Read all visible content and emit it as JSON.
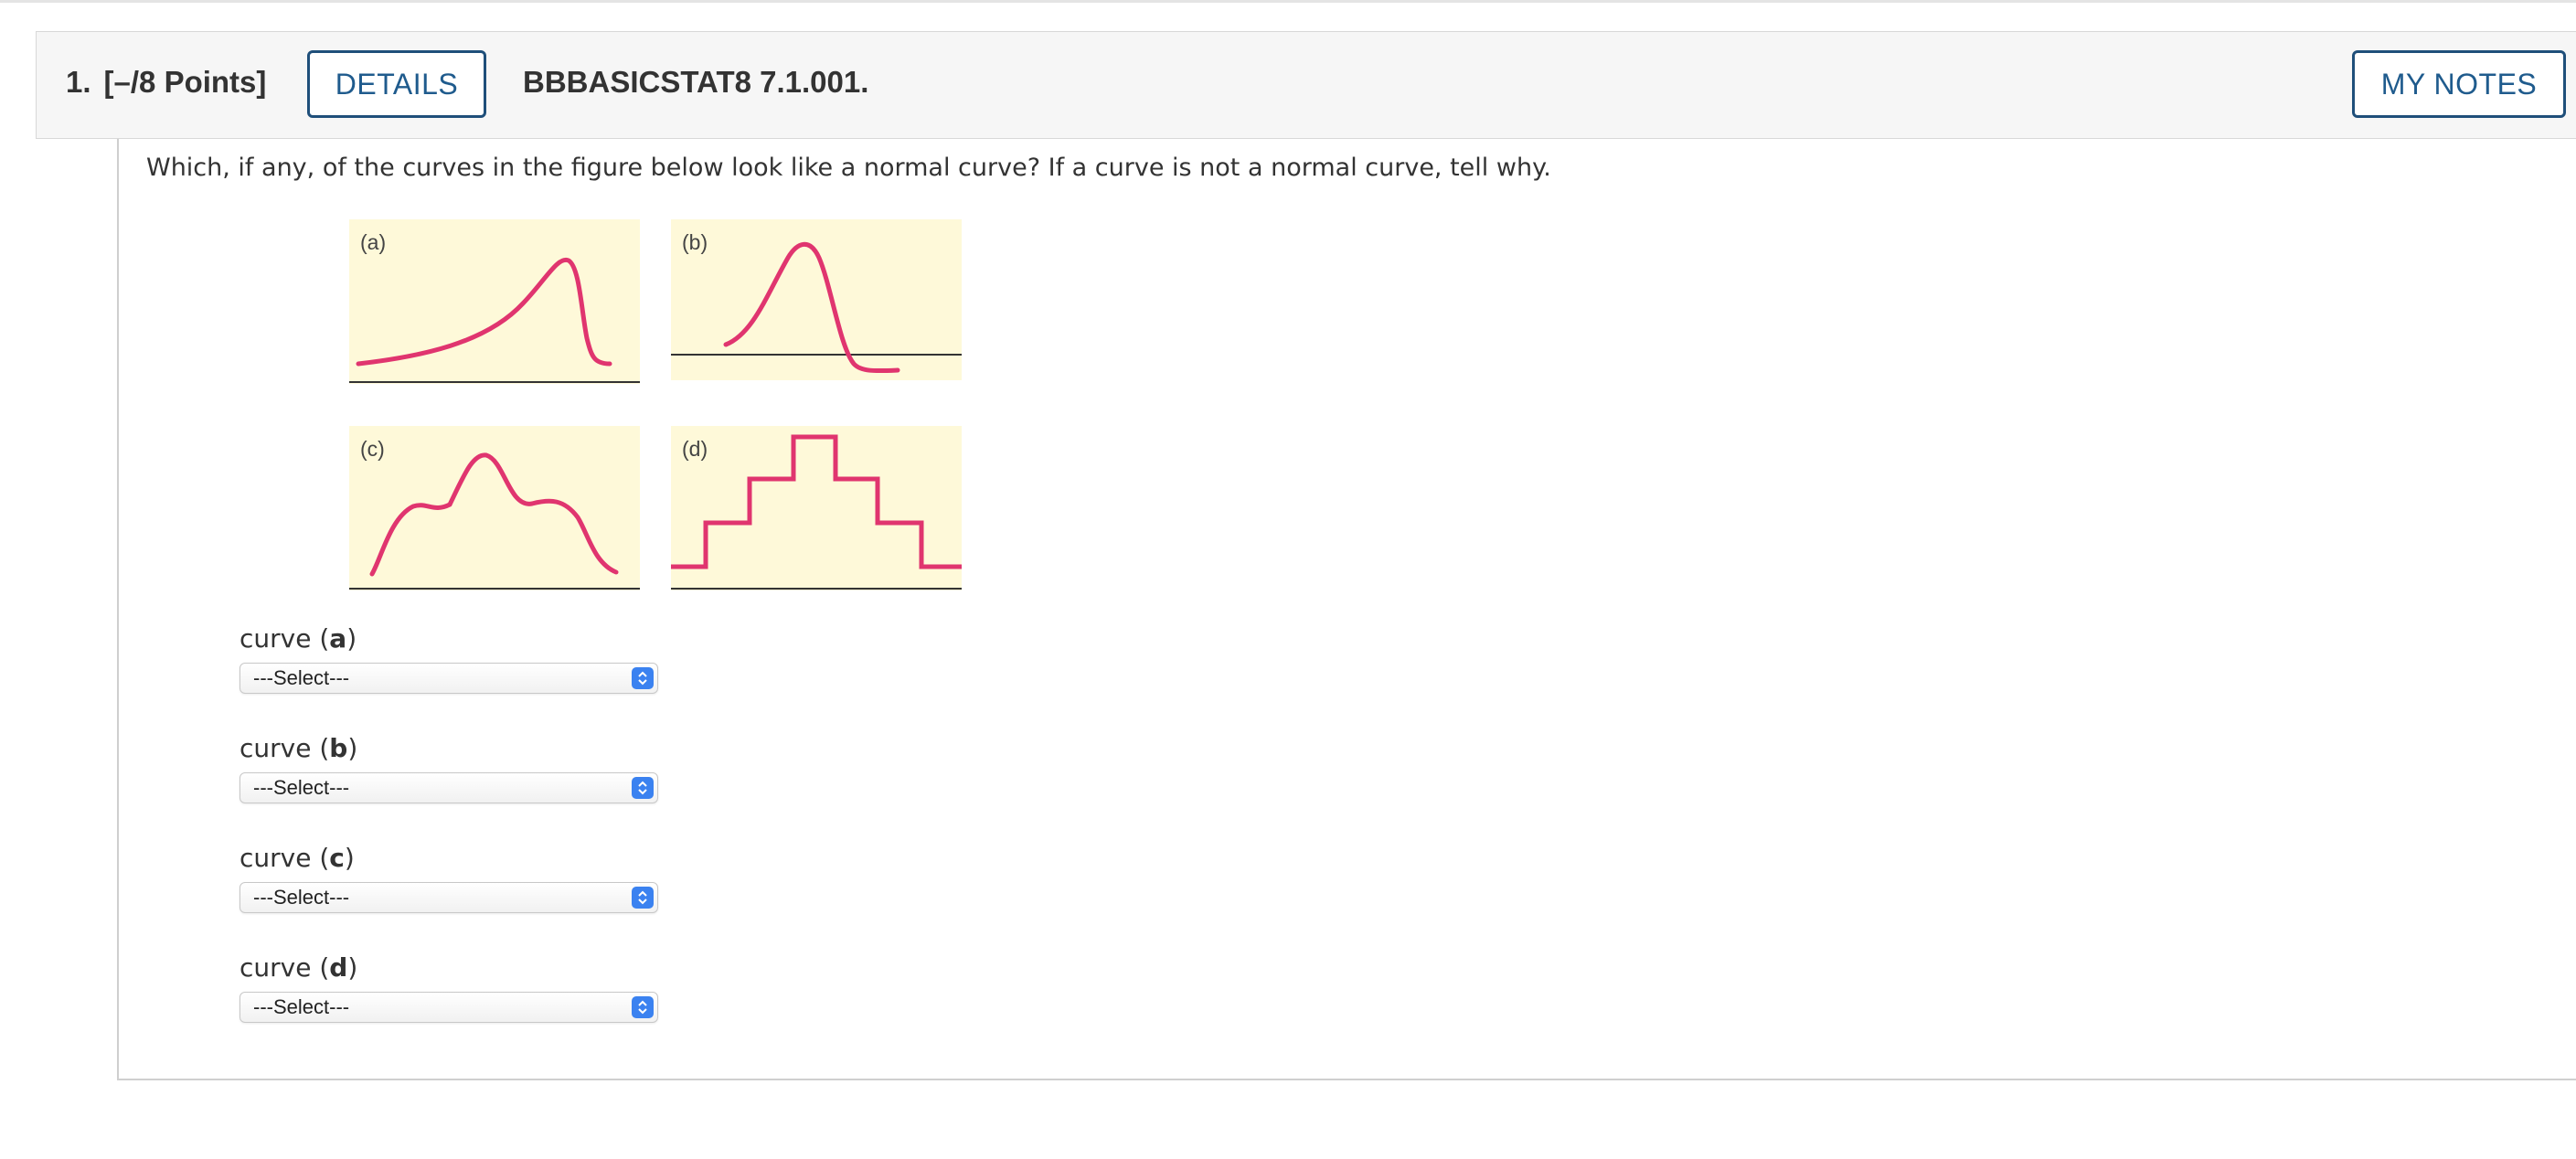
{
  "header": {
    "question_number": "1.",
    "points": "[–/8 Points]",
    "details_label": "DETAILS",
    "question_code": "BBBASICSTAT8 7.1.001.",
    "my_notes_label": "MY NOTES"
  },
  "question": {
    "text": "Which, if any, of the curves in the figure below look like a normal curve? If a curve is not a normal curve, tell why."
  },
  "figure": {
    "panels": [
      {
        "label": "(a)"
      },
      {
        "label": "(b)"
      },
      {
        "label": "(c)"
      },
      {
        "label": "(d)"
      }
    ],
    "curve_color": "#e0356f",
    "panel_color": "#fef9d9"
  },
  "answers": [
    {
      "prefix": "curve (",
      "letter": "a",
      "suffix": ")",
      "selected": "---Select---"
    },
    {
      "prefix": "curve (",
      "letter": "b",
      "suffix": ")",
      "selected": "---Select---"
    },
    {
      "prefix": "curve (",
      "letter": "c",
      "suffix": ")",
      "selected": "---Select---"
    },
    {
      "prefix": "curve (",
      "letter": "d",
      "suffix": ")",
      "selected": "---Select---"
    }
  ],
  "colors": {
    "accent": "#1f5b8d",
    "select_arrow": "#3b82f0"
  }
}
